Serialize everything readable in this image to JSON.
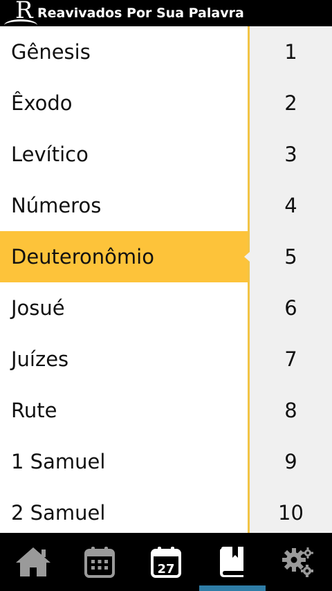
{
  "app": {
    "title": "Reavivados Por Sua Palavra",
    "logo_letter": "R"
  },
  "books": [
    {
      "name": "Gênesis"
    },
    {
      "name": "Êxodo"
    },
    {
      "name": "Levítico"
    },
    {
      "name": "Números"
    },
    {
      "name": "Deuteronômio",
      "selected": true
    },
    {
      "name": "Josué"
    },
    {
      "name": "Juízes"
    },
    {
      "name": "Rute"
    },
    {
      "name": "1 Samuel"
    },
    {
      "name": "2 Samuel"
    }
  ],
  "chapters": [
    "1",
    "2",
    "3",
    "4",
    "5",
    "6",
    "7",
    "8",
    "9",
    "10"
  ],
  "tabs": [
    {
      "name": "home",
      "icon": "home-icon"
    },
    {
      "name": "calendar",
      "icon": "calendar-icon"
    },
    {
      "name": "today",
      "icon": "calendar-day-icon",
      "day": "27"
    },
    {
      "name": "bible",
      "icon": "book-icon",
      "active": true
    },
    {
      "name": "settings",
      "icon": "gears-icon"
    }
  ],
  "colors": {
    "selected": "#fdc33a",
    "divider": "#f2c446",
    "chapter_bg": "#f0f0f0",
    "tab_active": "#2f7da6",
    "icon_gray": "#9a9a9a"
  }
}
